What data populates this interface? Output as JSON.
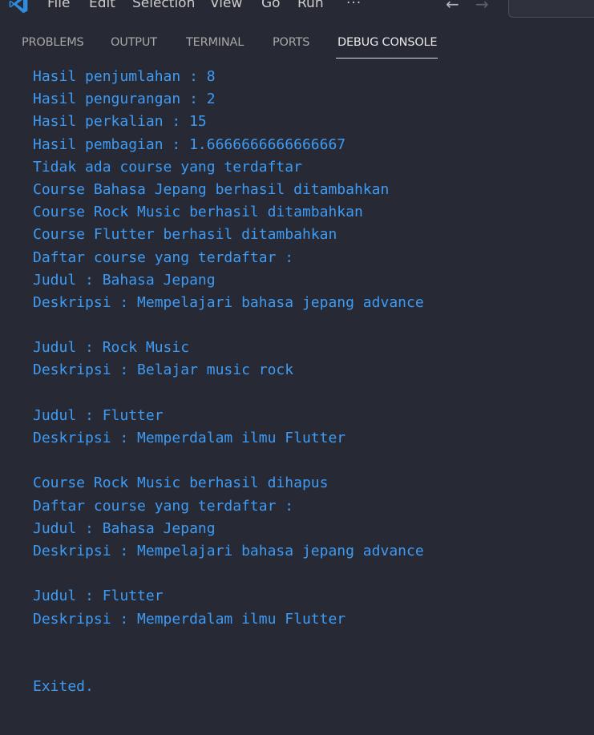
{
  "menu": {
    "items": [
      "File",
      "Edit",
      "Selection",
      "View",
      "Go",
      "Run"
    ],
    "more_label": "···",
    "back_arrow": "←",
    "forward_arrow": "→"
  },
  "panel": {
    "tabs": [
      {
        "label": "PROBLEMS"
      },
      {
        "label": "OUTPUT"
      },
      {
        "label": "TERMINAL"
      },
      {
        "label": "PORTS"
      },
      {
        "label": "DEBUG CONSOLE",
        "active": true
      }
    ]
  },
  "console": {
    "text_color": "#3e9bf5",
    "lines": [
      "Hasil penjumlahan : 8",
      "Hasil pengurangan : 2",
      "Hasil perkalian : 15",
      "Hasil pembagian : 1.6666666666666667",
      "Tidak ada course yang terdaftar",
      "Course Bahasa Jepang berhasil ditambahkan",
      "Course Rock Music berhasil ditambahkan",
      "Course Flutter berhasil ditambahkan",
      "Daftar course yang terdaftar :",
      "Judul : Bahasa Jepang",
      "Deskripsi : Mempelajari bahasa jepang advance",
      "",
      "Judul : Rock Music",
      "Deskripsi : Belajar music rock",
      "",
      "Judul : Flutter",
      "Deskripsi : Memperdalam ilmu Flutter",
      "",
      "Course Rock Music berhasil dihapus",
      "Daftar course yang terdaftar :",
      "Judul : Bahasa Jepang",
      "Deskripsi : Mempelajari bahasa jepang advance",
      "",
      "Judul : Flutter",
      "Deskripsi : Memperdalam ilmu Flutter",
      "",
      "",
      "Exited."
    ]
  }
}
